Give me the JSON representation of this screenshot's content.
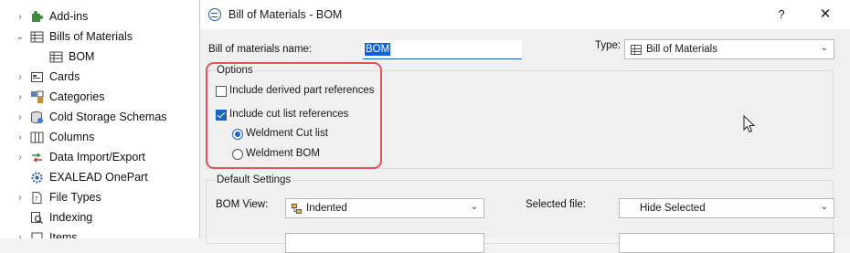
{
  "tree": {
    "items": [
      {
        "label": "Add-ins",
        "icon": "puzzle-icon",
        "chevron": "›"
      },
      {
        "label": "Bills of Materials",
        "icon": "table-icon",
        "chevron": "⌄"
      },
      {
        "label": "BOM",
        "icon": "table-icon",
        "chevron": ""
      },
      {
        "label": "Cards",
        "icon": "card-icon",
        "chevron": "›"
      },
      {
        "label": "Categories",
        "icon": "categories-icon",
        "chevron": "›"
      },
      {
        "label": "Cold Storage Schemas",
        "icon": "database-icon",
        "chevron": "›"
      },
      {
        "label": "Columns",
        "icon": "columns-icon",
        "chevron": "›"
      },
      {
        "label": "Data Import/Export",
        "icon": "import-export-icon",
        "chevron": "›"
      },
      {
        "label": "EXALEAD OnePart",
        "icon": "gear-icon",
        "chevron": ""
      },
      {
        "label": "File Types",
        "icon": "file-types-icon",
        "chevron": "›"
      },
      {
        "label": "Indexing",
        "icon": "search-icon",
        "chevron": ""
      },
      {
        "label": "Items",
        "icon": "items-icon",
        "chevron": "›"
      }
    ]
  },
  "dialog": {
    "title": "Bill of Materials - BOM",
    "help_label": "?",
    "close_label": "✕",
    "name_label": "Bill of materials name:",
    "name_value": "BOM",
    "type_label": "Type:",
    "type_value": "Bill of Materials",
    "options": {
      "title": "Options",
      "derived_label": "Include derived part references",
      "derived_checked": false,
      "cutlist_label": "Include cut list references",
      "cutlist_checked": true,
      "weldment_cut_list_label": "Weldment Cut list",
      "weldment_bom_label": "Weldment BOM",
      "selected_radio": "Weldment Cut list"
    },
    "default_settings": {
      "title": "Default Settings",
      "bom_view_label": "BOM View:",
      "bom_view_value": "Indented",
      "selected_file_label": "Selected file:",
      "selected_file_value": "Hide Selected"
    }
  },
  "colors": {
    "accent": "#1c64c9",
    "highlight": "#e0545a",
    "selection": "#0a64d8"
  }
}
